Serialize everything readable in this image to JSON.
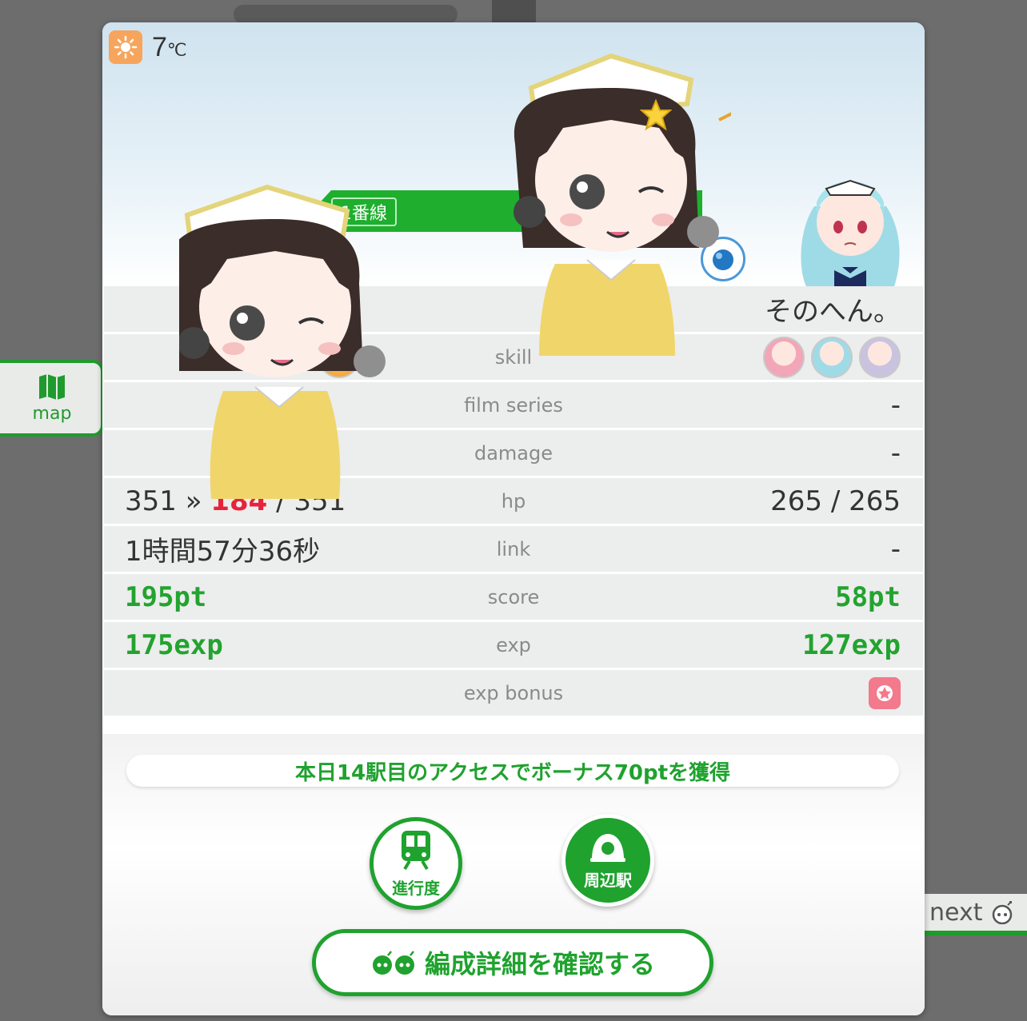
{
  "weather": {
    "icon": "sun-icon",
    "temperature": "7",
    "unit": "℃"
  },
  "line": {
    "label": "1番線"
  },
  "opponent": {
    "name": "そのへん。"
  },
  "table": {
    "skill": {
      "label": "skill"
    },
    "film_series": {
      "label": "film series",
      "right": "-"
    },
    "damage": {
      "label": "damage",
      "right": "-"
    },
    "hp": {
      "label": "hp",
      "left_before": "351",
      "arrow": "»",
      "left_after": "184",
      "left_sep": "/",
      "left_max": "351",
      "right": "265 / 265"
    },
    "link": {
      "label": "link",
      "left": "1時間57分36秒",
      "right": "-"
    },
    "score": {
      "label": "score",
      "left": "195pt",
      "right": "58pt"
    },
    "exp": {
      "label": "exp",
      "left": "175exp",
      "right": "127exp"
    },
    "exp_bonus": {
      "label": "exp bonus"
    }
  },
  "bonus_message": "本日14駅目のアクセスでボーナス70ptを獲得",
  "buttons": {
    "progress": "進行度",
    "nearby": "周辺駅",
    "formation": "編成詳細を確認する"
  },
  "side": {
    "map": "map",
    "next": "next"
  },
  "colors": {
    "accent": "#1fa22e",
    "damage": "#e8223a"
  }
}
